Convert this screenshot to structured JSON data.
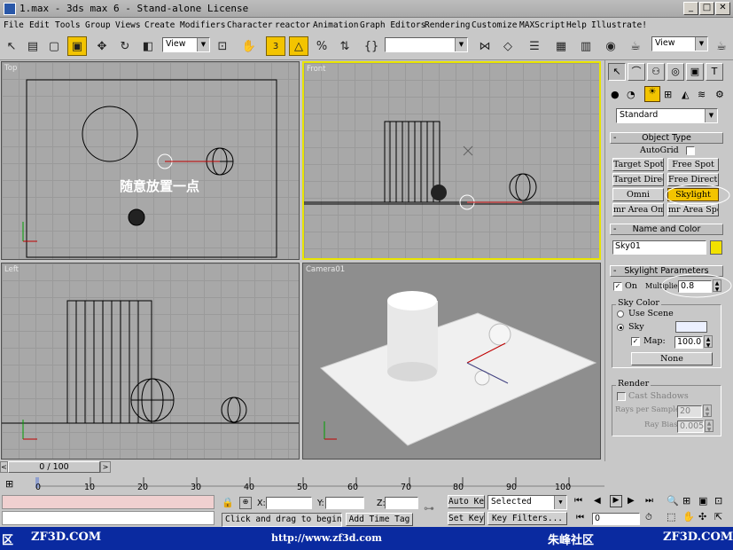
{
  "window": {
    "title": "1.max - 3ds max 6 - Stand-alone License"
  },
  "menu": [
    "File",
    "Edit",
    "Tools",
    "Group",
    "Views",
    "Create",
    "Modifiers",
    "Character",
    "reactor",
    "Animation",
    "Graph Editors",
    "Rendering",
    "Customize",
    "MAXScript",
    "Help",
    "Illustrate!"
  ],
  "toolbar": {
    "view_dropdown": "View",
    "view_dropdown2": "View",
    "snap_label": "3"
  },
  "viewports": {
    "top": "Top",
    "front": "Front",
    "left": "Left",
    "camera": "Camera01"
  },
  "annotation": "随意放置一点",
  "panel": {
    "category_dropdown": "Standard",
    "object_type": {
      "header": "Object Type",
      "autogrid": "AutoGrid",
      "buttons": [
        "Target Spot",
        "Free Spot",
        "Target Direct",
        "Free Direct",
        "Omni",
        "Skylight",
        "mr Area Omni",
        "mr Area Spot"
      ]
    },
    "name_color": {
      "header": "Name and Color",
      "name": "Sky01",
      "color": "#f2e100"
    },
    "skylight": {
      "header": "Skylight Parameters",
      "on_label": "On",
      "multiplier_label": "Multiplier:",
      "multiplier_value": "0.8",
      "sky_color_label": "Sky Color",
      "use_scene_label": "Use Scene",
      "sky_label": "Sky",
      "map_label": "Map:",
      "map_value": "100.0",
      "none_button": "None"
    },
    "render": {
      "header": "Render",
      "cast_shadows": "Cast Shadows",
      "rays_label": "Rays per Sample:",
      "rays_value": "20",
      "bias_label": "Ray Bias:",
      "bias_value": "0.005"
    }
  },
  "timeline": {
    "frame": "0 / 100",
    "ticks": [
      "0",
      "10",
      "20",
      "30",
      "40",
      "50",
      "60",
      "70",
      "80",
      "90",
      "100"
    ]
  },
  "status": {
    "x_label": "X:",
    "y_label": "Y:",
    "z_label": "Z:",
    "prompt": "Click and drag to begin",
    "add_time_tag": "Add Time Tag",
    "auto_key": "Auto Key",
    "set_key": "Set Key",
    "selected": "Selected",
    "key_filters": "Key Filters...",
    "frame_field": "0"
  },
  "banner": {
    "left_text": "区",
    "site1": "ZF3D.COM",
    "url": "http://www.zf3d.com",
    "brand": "朱峰社区",
    "site2": "ZF3D.COM"
  }
}
